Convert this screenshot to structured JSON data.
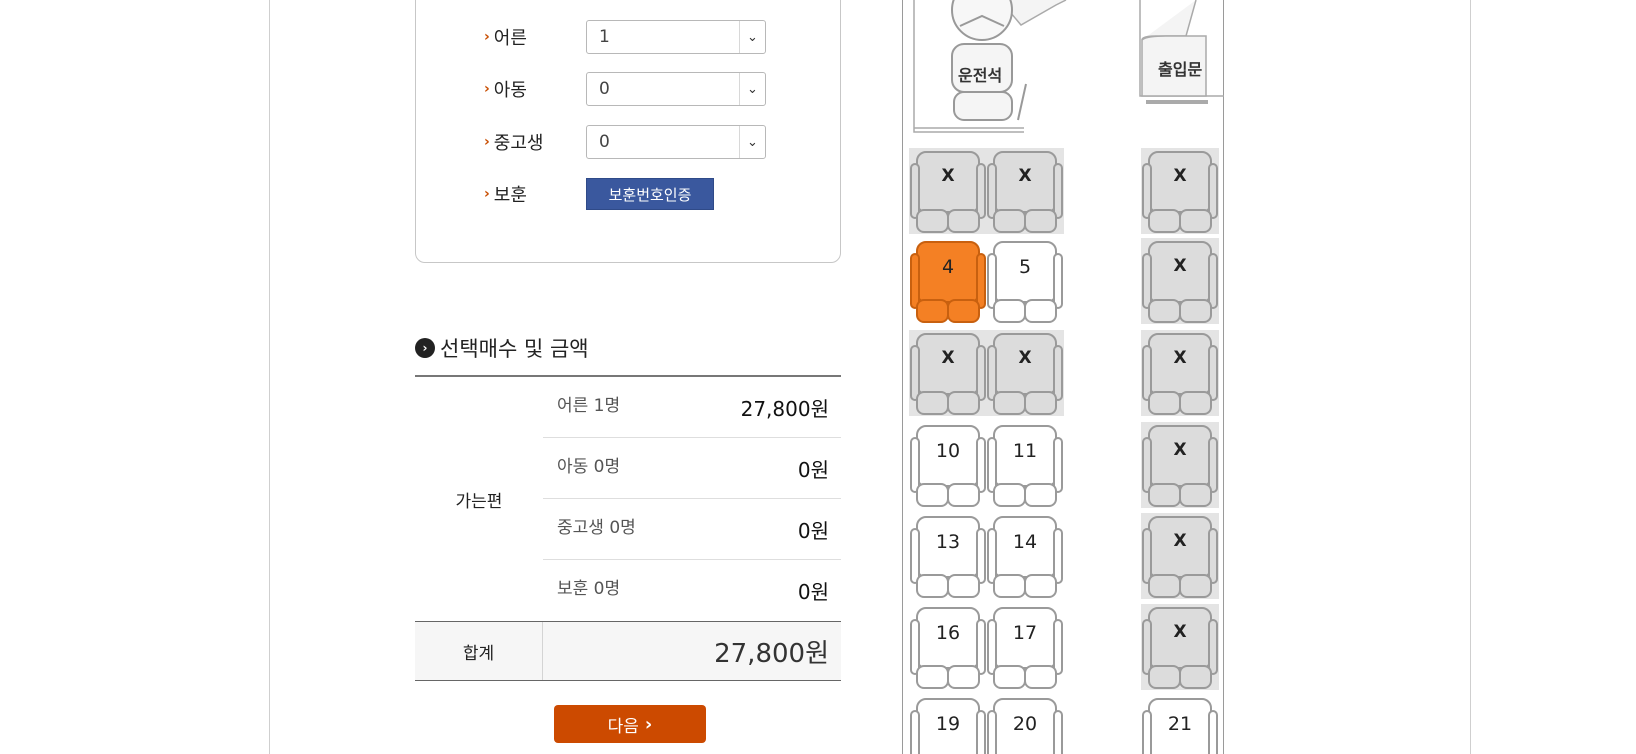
{
  "passengers": {
    "rows": [
      {
        "label": "어른",
        "value": "1",
        "kind": "select"
      },
      {
        "label": "아동",
        "value": "0",
        "kind": "select"
      },
      {
        "label": "중고생",
        "value": "0",
        "kind": "select"
      },
      {
        "label": "보훈",
        "button": "보훈번호인증",
        "kind": "button"
      }
    ]
  },
  "summary": {
    "title": "선택매수 및 금액",
    "group_label": "가는편",
    "lines": [
      {
        "label": "어른 1명",
        "amount": "27,800원"
      },
      {
        "label": "아동 0명",
        "amount": "0원"
      },
      {
        "label": "중고생 0명",
        "amount": "0원"
      },
      {
        "label": "보훈 0명",
        "amount": "0원"
      }
    ],
    "total_label": "합계",
    "total_amount": "27,800원"
  },
  "next_button": "다음",
  "bus": {
    "driver_label": "운전석",
    "door_label": "출입문",
    "seats": [
      {
        "id": "s1",
        "text": "X",
        "state": "blocked"
      },
      {
        "id": "s2",
        "text": "X",
        "state": "blocked"
      },
      {
        "id": "s3",
        "text": "X",
        "state": "blocked"
      },
      {
        "id": "s4",
        "text": "4",
        "state": "selected"
      },
      {
        "id": "s5",
        "text": "5",
        "state": "available"
      },
      {
        "id": "s6",
        "text": "X",
        "state": "blocked"
      },
      {
        "id": "s7",
        "text": "X",
        "state": "blocked"
      },
      {
        "id": "s8",
        "text": "X",
        "state": "blocked"
      },
      {
        "id": "s9",
        "text": "X",
        "state": "blocked"
      },
      {
        "id": "s10",
        "text": "10",
        "state": "available"
      },
      {
        "id": "s11",
        "text": "11",
        "state": "available"
      },
      {
        "id": "s12",
        "text": "X",
        "state": "blocked"
      },
      {
        "id": "s13",
        "text": "13",
        "state": "available"
      },
      {
        "id": "s14",
        "text": "14",
        "state": "available"
      },
      {
        "id": "s15",
        "text": "X",
        "state": "blocked"
      },
      {
        "id": "s16",
        "text": "16",
        "state": "available"
      },
      {
        "id": "s17",
        "text": "17",
        "state": "available"
      },
      {
        "id": "s18",
        "text": "X",
        "state": "blocked"
      },
      {
        "id": "s19",
        "text": "19",
        "state": "available"
      },
      {
        "id": "s20",
        "text": "20",
        "state": "available"
      },
      {
        "id": "s21",
        "text": "21",
        "state": "available"
      }
    ]
  },
  "colors": {
    "accent_orange": "#cc4a00",
    "seat_selected": "#f48024",
    "verify_blue": "#3a589e",
    "seat_blocked_bg": "#e4e4e4"
  }
}
